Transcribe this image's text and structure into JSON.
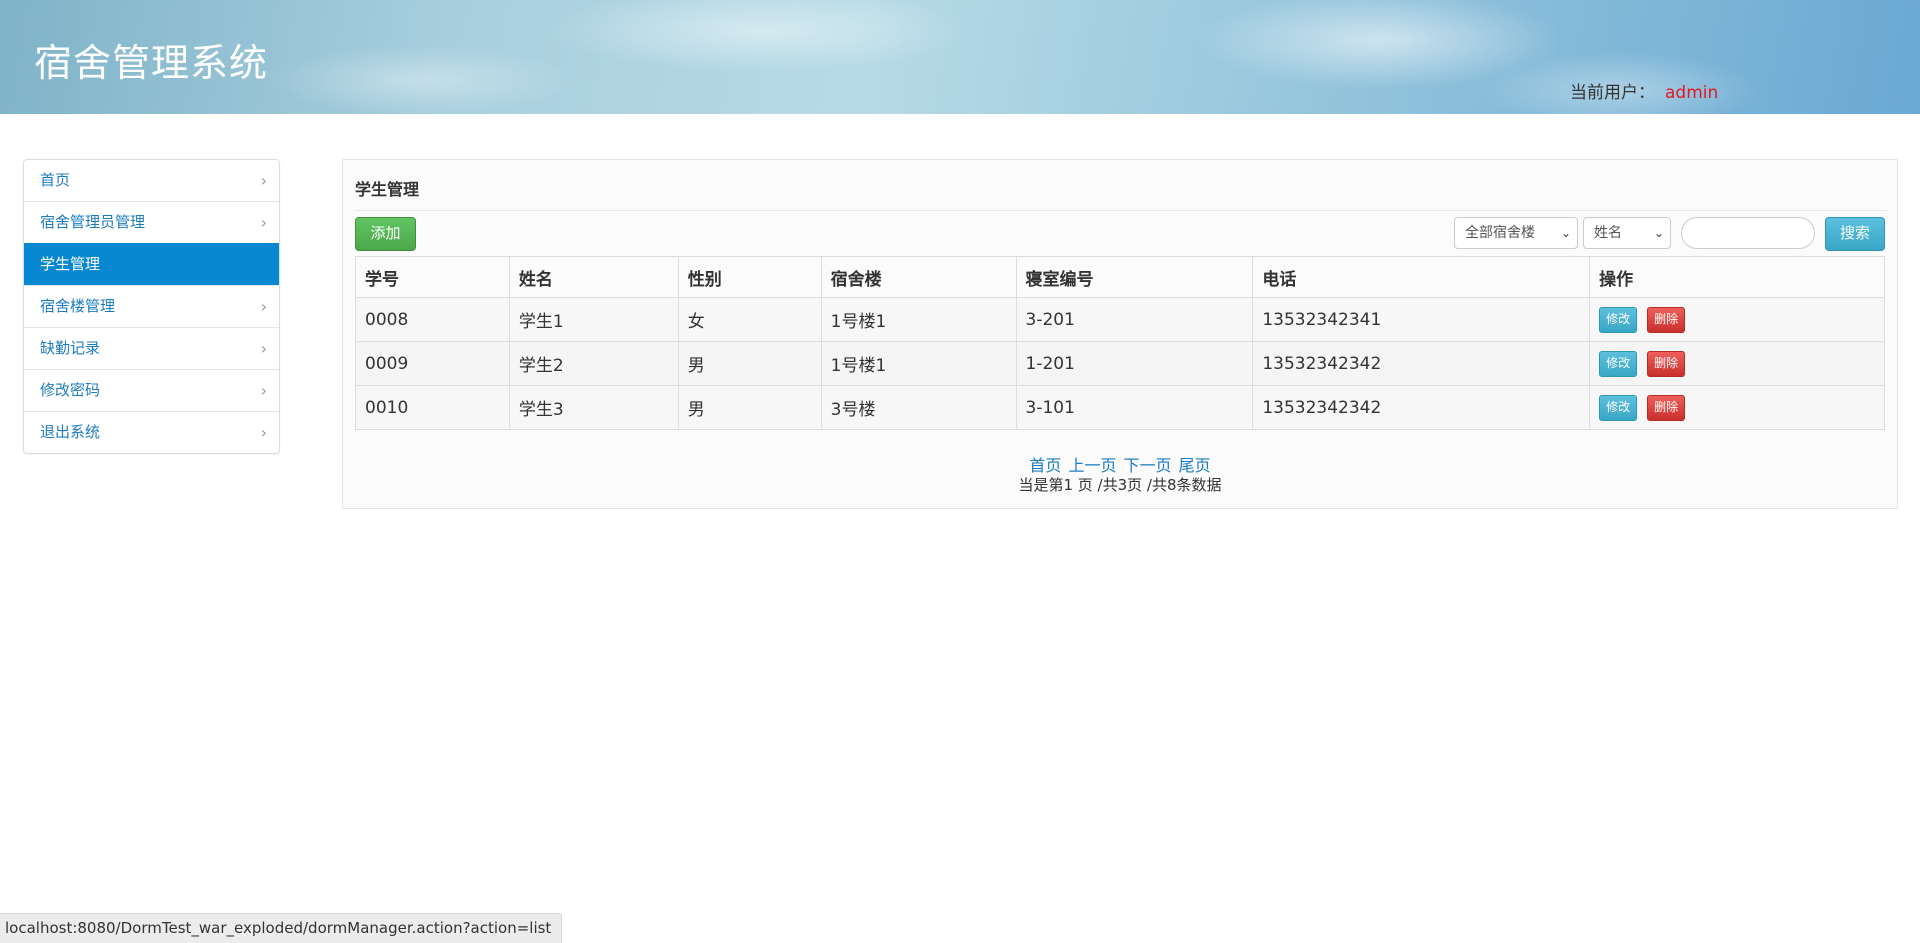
{
  "header": {
    "title": "宿舍管理系统",
    "user_label": "当前用户：",
    "user_name": "admin"
  },
  "sidebar": {
    "items": [
      {
        "label": "首页",
        "active": false
      },
      {
        "label": "宿舍管理员管理",
        "active": false
      },
      {
        "label": "学生管理",
        "active": true
      },
      {
        "label": "宿舍楼管理",
        "active": false
      },
      {
        "label": "缺勤记录",
        "active": false
      },
      {
        "label": "修改密码",
        "active": false
      },
      {
        "label": "退出系统",
        "active": false
      }
    ]
  },
  "main": {
    "title": "学生管理",
    "add_label": "添加",
    "building_select": "全部宿舍楼",
    "field_select": "姓名",
    "search_value": "",
    "search_label": "搜索",
    "table": {
      "headers": [
        "学号",
        "姓名",
        "性别",
        "宿舍楼",
        "寝室编号",
        "电话",
        "操作"
      ],
      "rows": [
        [
          "0008",
          "学生1",
          "女",
          "1号楼1",
          "3-201",
          "13532342341"
        ],
        [
          "0009",
          "学生2",
          "男",
          "1号楼1",
          "1-201",
          "13532342342"
        ],
        [
          "0010",
          "学生3",
          "男",
          "3号楼",
          "3-101",
          "13532342342"
        ]
      ],
      "edit_label": "修改",
      "delete_label": "删除"
    },
    "pager": {
      "first": "首页",
      "prev": "上一页",
      "next": "下一页",
      "last": "尾页",
      "info": "当是第1 页 /共3页  /共8条数据"
    }
  },
  "statusbar": {
    "url": "localhost:8080/DormTest_war_exploded/dormManager.action?action=list"
  },
  "colors": {
    "accent": "#0888d1",
    "link": "#1c7cc1",
    "add": "#5cb85c",
    "info": "#5bc0de",
    "danger": "#d9534f",
    "username": "#e4161e"
  }
}
